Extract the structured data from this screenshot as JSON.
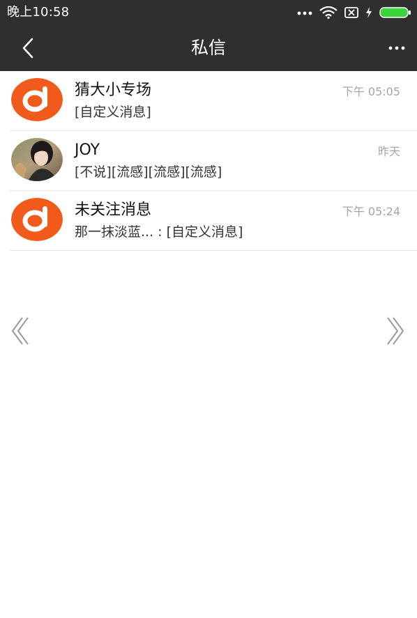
{
  "status_bar": {
    "time": "晚上10:58"
  },
  "header": {
    "title": "私信"
  },
  "messages": [
    {
      "name": "猜大小专场",
      "preview": "[自定义消息]",
      "time": "下午 05:05",
      "avatar": "brand-logo-icon"
    },
    {
      "name": "JOY",
      "preview": "[不说][流感][流感][流感]",
      "time": "昨天",
      "avatar": "user-photo"
    },
    {
      "name": "未关注消息",
      "preview": "那一抹淡蓝... : [自定义消息]",
      "time": "下午 05:24",
      "avatar": "brand-logo-icon"
    }
  ],
  "colors": {
    "bar_background": "#2f2f2f",
    "brand_orange": "#f05a1a",
    "divider": "#e5e5e5",
    "time_text": "#a5a5a5"
  }
}
